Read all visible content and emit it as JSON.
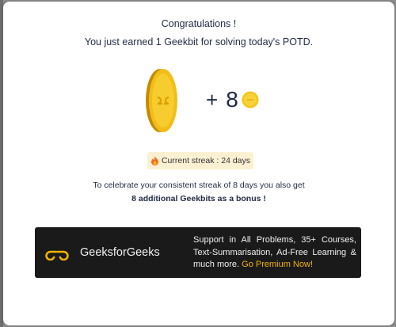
{
  "modal": {
    "title": "Congratulations !",
    "subtitle": "You just earned 1 Geekbit for solving today's POTD."
  },
  "reward": {
    "plus": "+",
    "amount": "8",
    "coin_icon": "geekbit-coin-icon"
  },
  "streak": {
    "icon": "fire-icon",
    "text": "Current streak : 24 days"
  },
  "bonus": {
    "line1": "To celebrate your consistent streak of 8 days you also get",
    "line2": "8 additional Geekbits as a bonus !"
  },
  "promo_banner": {
    "brand": "GeeksforGeeks",
    "text": "Support in All Problems, 35+ Courses, Text-Summarisation, Ad-Free Learning & much more.",
    "cta": "Go Premium Now!"
  },
  "colors": {
    "coin": "#f5c518",
    "cta": "#f0b400",
    "banner_bg": "#1a1a1a",
    "streak_bg": "#fbf1d2",
    "logo_green": "#2f8d46"
  }
}
